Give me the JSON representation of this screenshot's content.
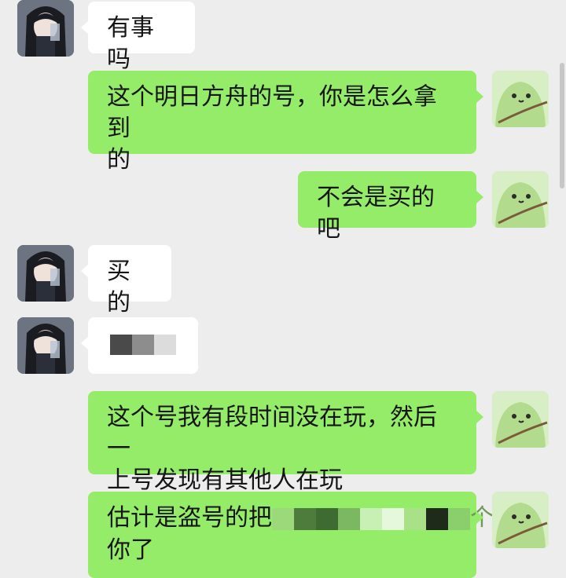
{
  "messages": [
    {
      "side": "left",
      "text": "有事吗"
    },
    {
      "side": "right",
      "line1": "这个明日方舟的号，你是怎么拿到",
      "line2": "的"
    },
    {
      "side": "right",
      "text": "不会是买的吧"
    },
    {
      "side": "left",
      "text": "买的"
    },
    {
      "side": "left",
      "text": ""
    },
    {
      "side": "right",
      "line1": "这个号我有段时间没在玩，然后一",
      "line2": "上号发现有其他人在玩"
    },
    {
      "side": "right",
      "line1_visible": "估计是盗号的把",
      "line1_tail": "个",
      "line2": "你了"
    }
  ],
  "colors": {
    "background": "#ededed",
    "incoming_bubble": "#ffffff",
    "outgoing_bubble": "#95ec69"
  },
  "icons": {
    "contact_avatar": "anime-girl-avatar-icon",
    "self_avatar": "green-blob-avatar-icon"
  }
}
